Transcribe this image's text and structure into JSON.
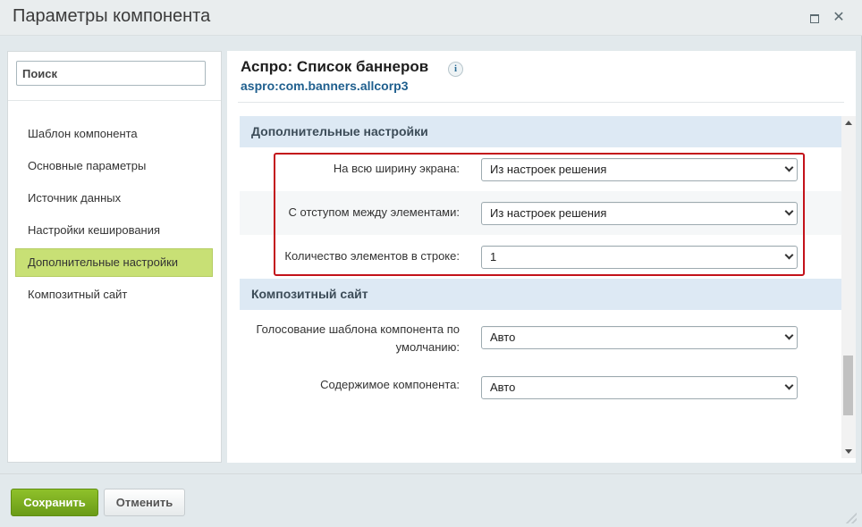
{
  "window": {
    "title": "Параметры компонента",
    "maximize_icon": "maximize-icon",
    "close_icon": "close-icon",
    "close_glyph": "✕"
  },
  "search": {
    "placeholder": "Поиск",
    "value": ""
  },
  "sidebar": {
    "items": [
      {
        "label": "Шаблон компонента",
        "active": false
      },
      {
        "label": "Основные параметры",
        "active": false
      },
      {
        "label": "Источник данных",
        "active": false
      },
      {
        "label": "Настройки кеширования",
        "active": false
      },
      {
        "label": "Дополнительные настройки",
        "active": true
      },
      {
        "label": "Композитный сайт",
        "active": false
      }
    ]
  },
  "component": {
    "title": "Аспро: Список баннеров",
    "info_glyph": "i",
    "code": "aspro:com.banners.allcorp3"
  },
  "sections": [
    {
      "title": "Дополнительные настройки",
      "rows": [
        {
          "label": "На всю ширину экрана:",
          "value": "Из настроек решения"
        },
        {
          "label": "С отступом между элементами:",
          "value": "Из настроек решения"
        },
        {
          "label": "Количество элементов в строке:",
          "value": "1"
        }
      ]
    },
    {
      "title": "Композитный сайт",
      "rows": [
        {
          "label": "Голосование шаблона компонента по умолчанию:",
          "label_line1": "Голосование шаблона компонента по",
          "label_line2": "умолчанию:",
          "value": "Авто"
        },
        {
          "label": "Содержимое компонента:",
          "value": "Авто"
        }
      ]
    }
  ],
  "footer": {
    "save_label": "Сохранить",
    "cancel_label": "Отменить"
  },
  "colors": {
    "accent_green": "#6a9b17",
    "highlight_red": "#c3121a",
    "section_header_bg": "#dde9f4",
    "active_item_bg": "#c8e075",
    "link_blue": "#1f5f8e"
  }
}
